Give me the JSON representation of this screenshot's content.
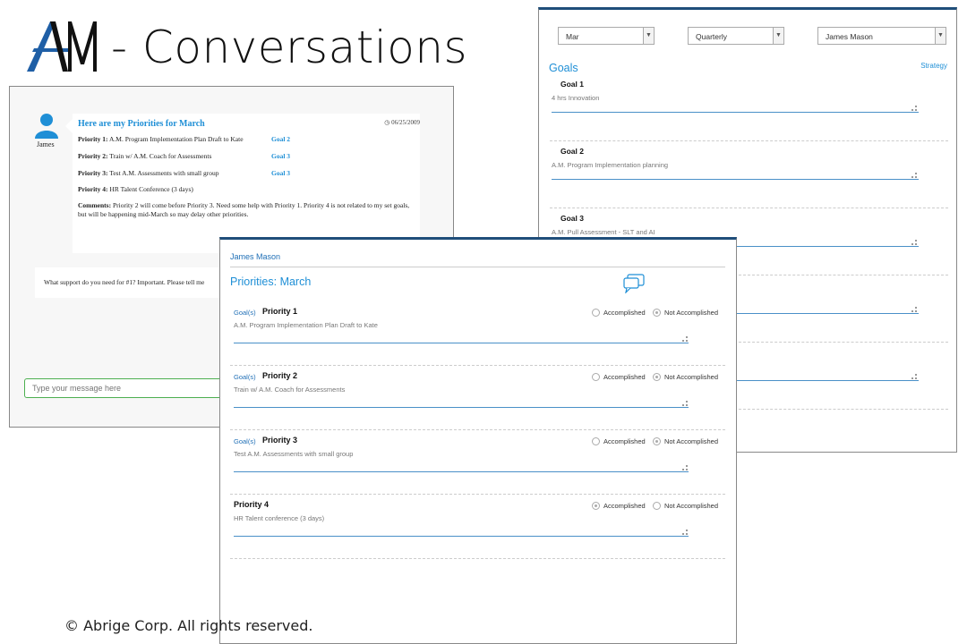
{
  "header": {
    "title": "- Conversations",
    "brand_color": "#1f4e7a"
  },
  "footer": {
    "copyright": "© Abrige Corp. All rights reserved."
  },
  "chat": {
    "author": "James",
    "title": "Here are my Priorities for March",
    "timestamp": "06/25/2009",
    "priorities": [
      {
        "label": "Priority 1:",
        "text": "A.M. Program Implementation Plan Draft to Kate",
        "goal": "Goal 2"
      },
      {
        "label": "Priority 2:",
        "text": "Train w/ A.M. Coach for Assessments",
        "goal": "Goal 3"
      },
      {
        "label": "Priority 3:",
        "text": "Test A.M. Assessments with small group",
        "goal": "Goal 3"
      },
      {
        "label": "Priority 4:",
        "text": "HR Talent Conference (3 days)",
        "goal": ""
      }
    ],
    "comments_label": "Comments:",
    "comments_text": "Priority 2 will come before Priority 3. Need some help with Priority 1. Priority 4 is not related to my set goals, but will be happening mid-March so may delay other priorities.",
    "reply": "What support do you need for #1? Important. Please tell me",
    "input_placeholder": "Type your message here"
  },
  "goals_window": {
    "month": "Mar",
    "period": "Quarterly",
    "person": "James Mason",
    "title": "Goals",
    "strategy_link": "Strategy",
    "goals": [
      {
        "label": "Goal 1",
        "value": "4 hrs Innovation"
      },
      {
        "label": "Goal 2",
        "value": "A.M. Program Implementation planning"
      },
      {
        "label": "Goal 3",
        "value": "A.M. Pull Assessment - SLT and AI"
      },
      {
        "label": "",
        "value": ""
      },
      {
        "label": "",
        "value": ""
      }
    ]
  },
  "priorities_window": {
    "user": "James Mason",
    "title": "Priorities: March",
    "goal_tag": "Goal(s)",
    "option_accomplished": "Accomplished",
    "option_not_accomplished": "Not Accomplished",
    "priorities": [
      {
        "name": "Priority 1",
        "value": "A.M. Program Implementation Plan Draft to Kate",
        "has_goal": true,
        "accomplished": false
      },
      {
        "name": "Priority 2",
        "value": "Train w/ A.M. Coach for Assessments",
        "has_goal": true,
        "accomplished": false
      },
      {
        "name": "Priority 3",
        "value": "Test A.M. Assessments with small group",
        "has_goal": true,
        "accomplished": false
      },
      {
        "name": "Priority 4",
        "value": "HR Talent conference (3 days)",
        "has_goal": false,
        "accomplished": true
      }
    ]
  }
}
